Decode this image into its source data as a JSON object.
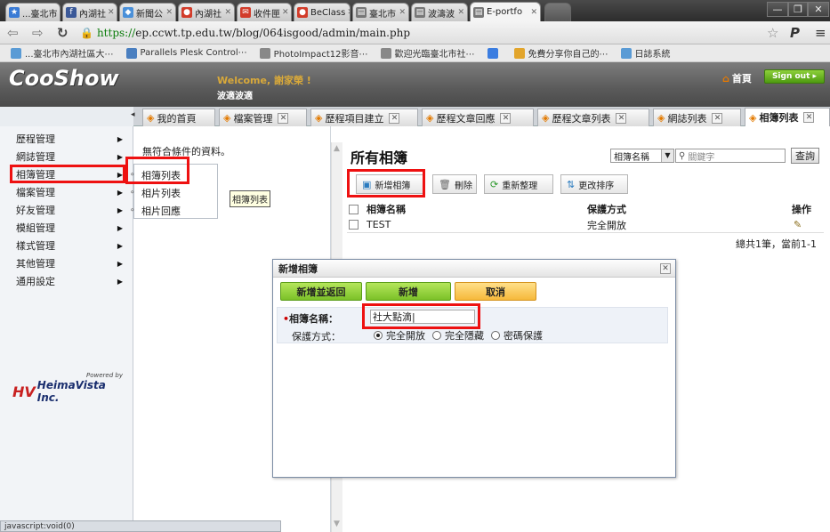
{
  "browser": {
    "tabs": [
      {
        "label": "...臺北市",
        "color": "#3a7bd5"
      },
      {
        "label": "內湖社",
        "color": "#3b5998"
      },
      {
        "label": "新聞公",
        "color": "#4a90d9"
      },
      {
        "label": "內湖社",
        "color": "#d23c2a"
      },
      {
        "label": "收件匣",
        "color": "#d23c2a"
      },
      {
        "label": "BeClass",
        "color": "#d23c2a"
      },
      {
        "label": "臺北市",
        "color": "#777777"
      },
      {
        "label": "波濤波",
        "color": "#777777"
      },
      {
        "label": "E-portfo",
        "color": "#777777"
      }
    ],
    "url_prefix": "https://",
    "url_rest": "ep.ccwt.tp.edu.tw/blog/064isgood/admin/main.php",
    "bookmarks": [
      {
        "label": "...臺北市內湖社區大⋯",
        "color": "#5a9bd5"
      },
      {
        "label": "Parallels Plesk Control⋯",
        "color": "#4a7fc0"
      },
      {
        "label": "PhotoImpact12影音⋯",
        "color": "#888888"
      },
      {
        "label": "歡迎光臨臺北市社⋯",
        "color": "#888888"
      },
      {
        "label": "",
        "color": "#3b7de0"
      },
      {
        "label": "免費分享你自己的⋯",
        "color": "#e2a52c"
      },
      {
        "label": "日誌系統",
        "color": "#5a9bd5"
      }
    ]
  },
  "app": {
    "logo": "CooShow",
    "welcome": "Welcome, 謝家榮 !",
    "blog_name": "波適波適",
    "home_label": "首頁",
    "signout_label": "Sign out",
    "tabs": [
      {
        "label": "我的首頁",
        "closable": false
      },
      {
        "label": "檔案管理",
        "closable": true
      },
      {
        "label": "歷程項目建立",
        "closable": true
      },
      {
        "label": "歷程文章回應",
        "closable": true
      },
      {
        "label": "歷程文章列表",
        "closable": true
      },
      {
        "label": "網誌列表",
        "closable": true
      },
      {
        "label": "相簿列表",
        "closable": true
      }
    ],
    "sidebar": [
      "歷程管理",
      "網誌管理",
      "相簿管理",
      "檔案管理",
      "好友管理",
      "模組管理",
      "樣式管理",
      "其他管理",
      "通用設定"
    ],
    "powered_by": "Powered by",
    "powered_name": "HeimaVista Inc.",
    "no_data": "無符合條件的資料。",
    "submenu": [
      "相簿列表",
      "相片列表",
      "相片回應"
    ],
    "tooltip": "相簿列表",
    "status": "javascript:void(0)"
  },
  "main": {
    "title": "所有相簿",
    "filter_value": "相簿名稱",
    "search_placeholder": "關鍵字",
    "query_label": "查詢",
    "toolbar": {
      "add": "新增相簿",
      "delete": "刪除",
      "reorganize": "重新整理",
      "reorder": "更改排序"
    },
    "columns": [
      "相簿名稱",
      "保護方式",
      "操作"
    ],
    "rows": [
      {
        "name": "TEST",
        "protection": "完全開放"
      }
    ],
    "footer": "總共1筆，當前1-1"
  },
  "dialog": {
    "title": "新增相簿",
    "btn_add_return": "新增並返回",
    "btn_add": "新增",
    "btn_cancel": "取消",
    "name_label": "相簿名稱：",
    "name_value": "社大點滴",
    "protect_label": "保護方式：",
    "options": [
      "完全開放",
      "完全隱藏",
      "密碼保護"
    ],
    "selected_option": "完全開放"
  },
  "colors": {
    "highlight": "#ee1111",
    "header_bg": "#5a5a5a",
    "signout_green": "#4e9a10",
    "dialog_green": "#7bc128",
    "dialog_orange": "#f6b93b"
  }
}
